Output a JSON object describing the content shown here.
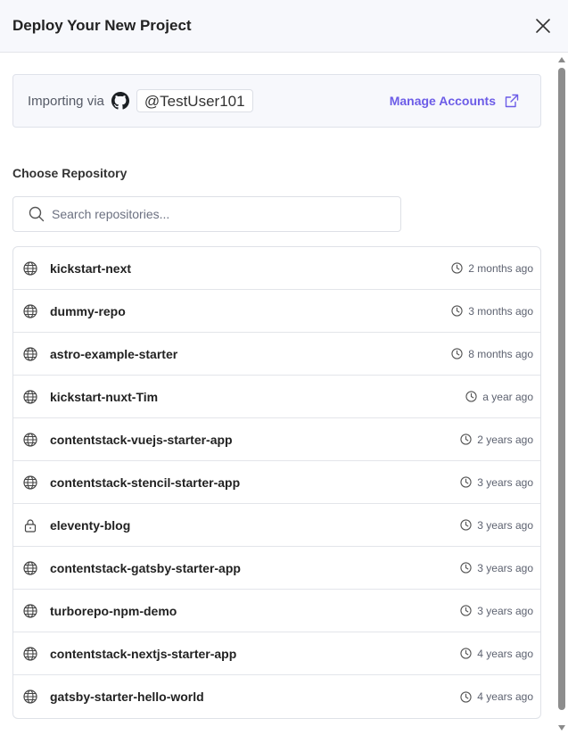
{
  "header": {
    "title": "Deploy Your New Project",
    "close_icon": "close-icon"
  },
  "importing": {
    "label": "Importing via",
    "provider_icon": "github-icon",
    "username": "@TestUser101",
    "manage_label": "Manage Accounts",
    "manage_icon": "external-link-icon",
    "accent_color": "#6c5ce7"
  },
  "repository": {
    "section_label": "Choose Repository",
    "search_placeholder": "Search repositories...",
    "search_value": "",
    "items": [
      {
        "name": "kickstart-next",
        "time": "2 months ago",
        "visibility": "public",
        "icon": "globe-icon"
      },
      {
        "name": "dummy-repo",
        "time": "3 months ago",
        "visibility": "public",
        "icon": "globe-icon"
      },
      {
        "name": "astro-example-starter",
        "time": "8 months ago",
        "visibility": "public",
        "icon": "globe-icon"
      },
      {
        "name": "kickstart-nuxt-Tim",
        "time": "a year ago",
        "visibility": "public",
        "icon": "globe-icon"
      },
      {
        "name": "contentstack-vuejs-starter-app",
        "time": "2 years ago",
        "visibility": "public",
        "icon": "globe-icon"
      },
      {
        "name": "contentstack-stencil-starter-app",
        "time": "3 years ago",
        "visibility": "public",
        "icon": "globe-icon"
      },
      {
        "name": "eleventy-blog",
        "time": "3 years ago",
        "visibility": "private",
        "icon": "lock-icon"
      },
      {
        "name": "contentstack-gatsby-starter-app",
        "time": "3 years ago",
        "visibility": "public",
        "icon": "globe-icon"
      },
      {
        "name": "turborepo-npm-demo",
        "time": "3 years ago",
        "visibility": "public",
        "icon": "globe-icon"
      },
      {
        "name": "contentstack-nextjs-starter-app",
        "time": "4 years ago",
        "visibility": "public",
        "icon": "globe-icon"
      },
      {
        "name": "gatsby-starter-hello-world",
        "time": "4 years ago",
        "visibility": "public",
        "icon": "globe-icon"
      }
    ]
  }
}
